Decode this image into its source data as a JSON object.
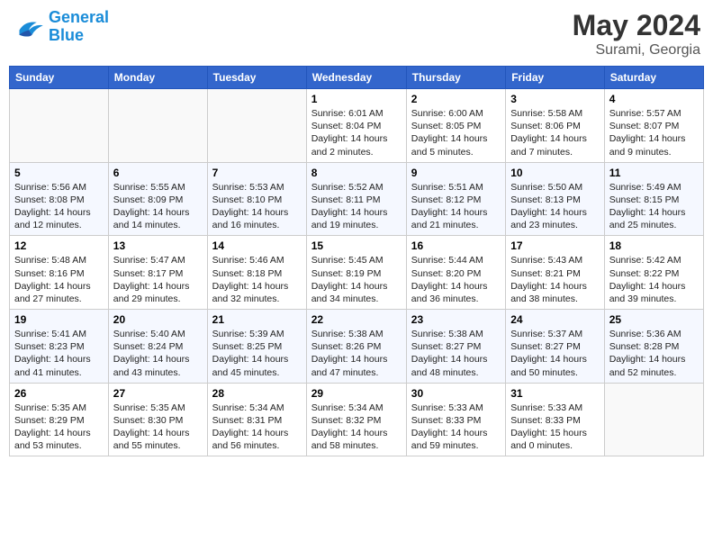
{
  "header": {
    "logo_line1": "General",
    "logo_line2": "Blue",
    "month_year": "May 2024",
    "location": "Surami, Georgia"
  },
  "weekdays": [
    "Sunday",
    "Monday",
    "Tuesday",
    "Wednesday",
    "Thursday",
    "Friday",
    "Saturday"
  ],
  "weeks": [
    [
      {
        "day": "",
        "info": ""
      },
      {
        "day": "",
        "info": ""
      },
      {
        "day": "",
        "info": ""
      },
      {
        "day": "1",
        "info": "Sunrise: 6:01 AM\nSunset: 8:04 PM\nDaylight: 14 hours\nand 2 minutes."
      },
      {
        "day": "2",
        "info": "Sunrise: 6:00 AM\nSunset: 8:05 PM\nDaylight: 14 hours\nand 5 minutes."
      },
      {
        "day": "3",
        "info": "Sunrise: 5:58 AM\nSunset: 8:06 PM\nDaylight: 14 hours\nand 7 minutes."
      },
      {
        "day": "4",
        "info": "Sunrise: 5:57 AM\nSunset: 8:07 PM\nDaylight: 14 hours\nand 9 minutes."
      }
    ],
    [
      {
        "day": "5",
        "info": "Sunrise: 5:56 AM\nSunset: 8:08 PM\nDaylight: 14 hours\nand 12 minutes."
      },
      {
        "day": "6",
        "info": "Sunrise: 5:55 AM\nSunset: 8:09 PM\nDaylight: 14 hours\nand 14 minutes."
      },
      {
        "day": "7",
        "info": "Sunrise: 5:53 AM\nSunset: 8:10 PM\nDaylight: 14 hours\nand 16 minutes."
      },
      {
        "day": "8",
        "info": "Sunrise: 5:52 AM\nSunset: 8:11 PM\nDaylight: 14 hours\nand 19 minutes."
      },
      {
        "day": "9",
        "info": "Sunrise: 5:51 AM\nSunset: 8:12 PM\nDaylight: 14 hours\nand 21 minutes."
      },
      {
        "day": "10",
        "info": "Sunrise: 5:50 AM\nSunset: 8:13 PM\nDaylight: 14 hours\nand 23 minutes."
      },
      {
        "day": "11",
        "info": "Sunrise: 5:49 AM\nSunset: 8:15 PM\nDaylight: 14 hours\nand 25 minutes."
      }
    ],
    [
      {
        "day": "12",
        "info": "Sunrise: 5:48 AM\nSunset: 8:16 PM\nDaylight: 14 hours\nand 27 minutes."
      },
      {
        "day": "13",
        "info": "Sunrise: 5:47 AM\nSunset: 8:17 PM\nDaylight: 14 hours\nand 29 minutes."
      },
      {
        "day": "14",
        "info": "Sunrise: 5:46 AM\nSunset: 8:18 PM\nDaylight: 14 hours\nand 32 minutes."
      },
      {
        "day": "15",
        "info": "Sunrise: 5:45 AM\nSunset: 8:19 PM\nDaylight: 14 hours\nand 34 minutes."
      },
      {
        "day": "16",
        "info": "Sunrise: 5:44 AM\nSunset: 8:20 PM\nDaylight: 14 hours\nand 36 minutes."
      },
      {
        "day": "17",
        "info": "Sunrise: 5:43 AM\nSunset: 8:21 PM\nDaylight: 14 hours\nand 38 minutes."
      },
      {
        "day": "18",
        "info": "Sunrise: 5:42 AM\nSunset: 8:22 PM\nDaylight: 14 hours\nand 39 minutes."
      }
    ],
    [
      {
        "day": "19",
        "info": "Sunrise: 5:41 AM\nSunset: 8:23 PM\nDaylight: 14 hours\nand 41 minutes."
      },
      {
        "day": "20",
        "info": "Sunrise: 5:40 AM\nSunset: 8:24 PM\nDaylight: 14 hours\nand 43 minutes."
      },
      {
        "day": "21",
        "info": "Sunrise: 5:39 AM\nSunset: 8:25 PM\nDaylight: 14 hours\nand 45 minutes."
      },
      {
        "day": "22",
        "info": "Sunrise: 5:38 AM\nSunset: 8:26 PM\nDaylight: 14 hours\nand 47 minutes."
      },
      {
        "day": "23",
        "info": "Sunrise: 5:38 AM\nSunset: 8:27 PM\nDaylight: 14 hours\nand 48 minutes."
      },
      {
        "day": "24",
        "info": "Sunrise: 5:37 AM\nSunset: 8:27 PM\nDaylight: 14 hours\nand 50 minutes."
      },
      {
        "day": "25",
        "info": "Sunrise: 5:36 AM\nSunset: 8:28 PM\nDaylight: 14 hours\nand 52 minutes."
      }
    ],
    [
      {
        "day": "26",
        "info": "Sunrise: 5:35 AM\nSunset: 8:29 PM\nDaylight: 14 hours\nand 53 minutes."
      },
      {
        "day": "27",
        "info": "Sunrise: 5:35 AM\nSunset: 8:30 PM\nDaylight: 14 hours\nand 55 minutes."
      },
      {
        "day": "28",
        "info": "Sunrise: 5:34 AM\nSunset: 8:31 PM\nDaylight: 14 hours\nand 56 minutes."
      },
      {
        "day": "29",
        "info": "Sunrise: 5:34 AM\nSunset: 8:32 PM\nDaylight: 14 hours\nand 58 minutes."
      },
      {
        "day": "30",
        "info": "Sunrise: 5:33 AM\nSunset: 8:33 PM\nDaylight: 14 hours\nand 59 minutes."
      },
      {
        "day": "31",
        "info": "Sunrise: 5:33 AM\nSunset: 8:33 PM\nDaylight: 15 hours\nand 0 minutes."
      },
      {
        "day": "",
        "info": ""
      }
    ]
  ]
}
